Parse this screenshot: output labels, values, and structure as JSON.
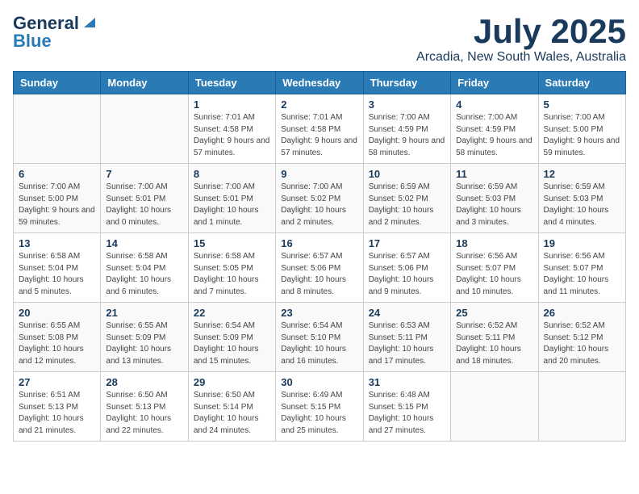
{
  "header": {
    "logo_general": "General",
    "logo_blue": "Blue",
    "month": "July 2025",
    "location": "Arcadia, New South Wales, Australia"
  },
  "weekdays": [
    "Sunday",
    "Monday",
    "Tuesday",
    "Wednesday",
    "Thursday",
    "Friday",
    "Saturday"
  ],
  "weeks": [
    [
      {
        "day": "",
        "info": ""
      },
      {
        "day": "",
        "info": ""
      },
      {
        "day": "1",
        "info": "Sunrise: 7:01 AM\nSunset: 4:58 PM\nDaylight: 9 hours and 57 minutes."
      },
      {
        "day": "2",
        "info": "Sunrise: 7:01 AM\nSunset: 4:58 PM\nDaylight: 9 hours and 57 minutes."
      },
      {
        "day": "3",
        "info": "Sunrise: 7:00 AM\nSunset: 4:59 PM\nDaylight: 9 hours and 58 minutes."
      },
      {
        "day": "4",
        "info": "Sunrise: 7:00 AM\nSunset: 4:59 PM\nDaylight: 9 hours and 58 minutes."
      },
      {
        "day": "5",
        "info": "Sunrise: 7:00 AM\nSunset: 5:00 PM\nDaylight: 9 hours and 59 minutes."
      }
    ],
    [
      {
        "day": "6",
        "info": "Sunrise: 7:00 AM\nSunset: 5:00 PM\nDaylight: 9 hours and 59 minutes."
      },
      {
        "day": "7",
        "info": "Sunrise: 7:00 AM\nSunset: 5:01 PM\nDaylight: 10 hours and 0 minutes."
      },
      {
        "day": "8",
        "info": "Sunrise: 7:00 AM\nSunset: 5:01 PM\nDaylight: 10 hours and 1 minute."
      },
      {
        "day": "9",
        "info": "Sunrise: 7:00 AM\nSunset: 5:02 PM\nDaylight: 10 hours and 2 minutes."
      },
      {
        "day": "10",
        "info": "Sunrise: 6:59 AM\nSunset: 5:02 PM\nDaylight: 10 hours and 2 minutes."
      },
      {
        "day": "11",
        "info": "Sunrise: 6:59 AM\nSunset: 5:03 PM\nDaylight: 10 hours and 3 minutes."
      },
      {
        "day": "12",
        "info": "Sunrise: 6:59 AM\nSunset: 5:03 PM\nDaylight: 10 hours and 4 minutes."
      }
    ],
    [
      {
        "day": "13",
        "info": "Sunrise: 6:58 AM\nSunset: 5:04 PM\nDaylight: 10 hours and 5 minutes."
      },
      {
        "day": "14",
        "info": "Sunrise: 6:58 AM\nSunset: 5:04 PM\nDaylight: 10 hours and 6 minutes."
      },
      {
        "day": "15",
        "info": "Sunrise: 6:58 AM\nSunset: 5:05 PM\nDaylight: 10 hours and 7 minutes."
      },
      {
        "day": "16",
        "info": "Sunrise: 6:57 AM\nSunset: 5:06 PM\nDaylight: 10 hours and 8 minutes."
      },
      {
        "day": "17",
        "info": "Sunrise: 6:57 AM\nSunset: 5:06 PM\nDaylight: 10 hours and 9 minutes."
      },
      {
        "day": "18",
        "info": "Sunrise: 6:56 AM\nSunset: 5:07 PM\nDaylight: 10 hours and 10 minutes."
      },
      {
        "day": "19",
        "info": "Sunrise: 6:56 AM\nSunset: 5:07 PM\nDaylight: 10 hours and 11 minutes."
      }
    ],
    [
      {
        "day": "20",
        "info": "Sunrise: 6:55 AM\nSunset: 5:08 PM\nDaylight: 10 hours and 12 minutes."
      },
      {
        "day": "21",
        "info": "Sunrise: 6:55 AM\nSunset: 5:09 PM\nDaylight: 10 hours and 13 minutes."
      },
      {
        "day": "22",
        "info": "Sunrise: 6:54 AM\nSunset: 5:09 PM\nDaylight: 10 hours and 15 minutes."
      },
      {
        "day": "23",
        "info": "Sunrise: 6:54 AM\nSunset: 5:10 PM\nDaylight: 10 hours and 16 minutes."
      },
      {
        "day": "24",
        "info": "Sunrise: 6:53 AM\nSunset: 5:11 PM\nDaylight: 10 hours and 17 minutes."
      },
      {
        "day": "25",
        "info": "Sunrise: 6:52 AM\nSunset: 5:11 PM\nDaylight: 10 hours and 18 minutes."
      },
      {
        "day": "26",
        "info": "Sunrise: 6:52 AM\nSunset: 5:12 PM\nDaylight: 10 hours and 20 minutes."
      }
    ],
    [
      {
        "day": "27",
        "info": "Sunrise: 6:51 AM\nSunset: 5:13 PM\nDaylight: 10 hours and 21 minutes."
      },
      {
        "day": "28",
        "info": "Sunrise: 6:50 AM\nSunset: 5:13 PM\nDaylight: 10 hours and 22 minutes."
      },
      {
        "day": "29",
        "info": "Sunrise: 6:50 AM\nSunset: 5:14 PM\nDaylight: 10 hours and 24 minutes."
      },
      {
        "day": "30",
        "info": "Sunrise: 6:49 AM\nSunset: 5:15 PM\nDaylight: 10 hours and 25 minutes."
      },
      {
        "day": "31",
        "info": "Sunrise: 6:48 AM\nSunset: 5:15 PM\nDaylight: 10 hours and 27 minutes."
      },
      {
        "day": "",
        "info": ""
      },
      {
        "day": "",
        "info": ""
      }
    ]
  ]
}
